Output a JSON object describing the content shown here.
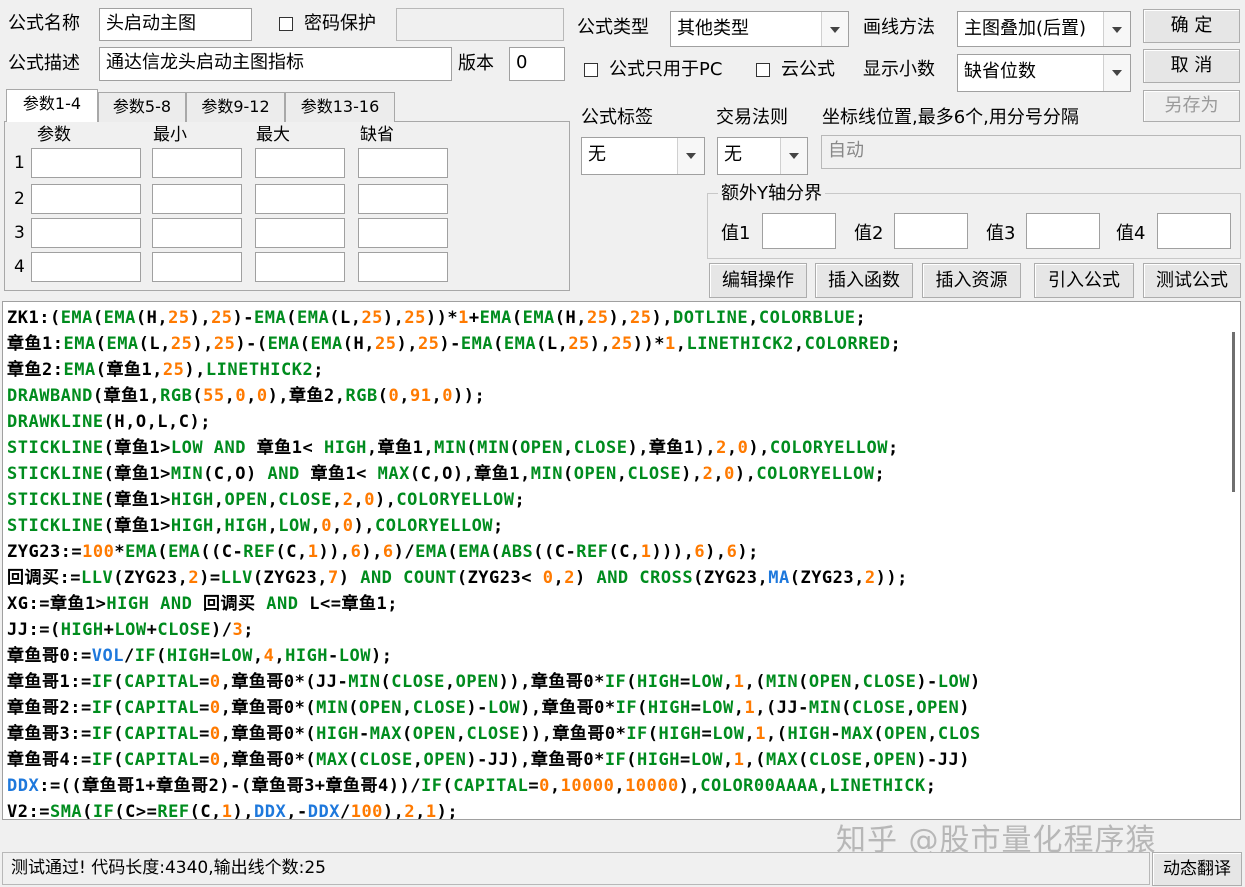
{
  "form": {
    "name_label": "公式名称",
    "name_value": "头启动主图",
    "password_label": "密码保护",
    "password_checked": false,
    "password_value": "",
    "desc_label": "公式描述",
    "desc_value": "通达信龙头启动主图指标",
    "version_label": "版本",
    "version_value": "0",
    "type_label": "公式类型",
    "type_value": "其他类型",
    "draw_label": "画线方法",
    "draw_value": "主图叠加(后置)",
    "pc_only_label": "公式只用于PC",
    "pc_only_checked": false,
    "cloud_label": "云公式",
    "cloud_checked": false,
    "decimals_label": "显示小数",
    "decimals_value": "缺省位数",
    "tag_label": "公式标签",
    "tag_value": "无",
    "trade_rule_label": "交易法则",
    "trade_rule_value": "无",
    "coord_label": "坐标线位置,最多6个,用分号分隔",
    "coord_value": "自动",
    "yaxis_group_label": "额外Y轴分界",
    "yaxis_values": [
      "值1",
      "值2",
      "值3",
      "值4"
    ]
  },
  "buttons": {
    "ok": "确  定",
    "cancel": "取  消",
    "save_as": "另存为",
    "edit_ops": "编辑操作",
    "insert_func": "插入函数",
    "insert_resource": "插入资源",
    "import_formula": "引入公式",
    "test_formula": "测试公式",
    "dynamic_translate": "动态翻译"
  },
  "tabs": [
    "参数1-4",
    "参数5-8",
    "参数9-12",
    "参数13-16"
  ],
  "param_table": {
    "headers": [
      "参数",
      "最小",
      "最大",
      "缺省"
    ],
    "rows": [
      "1",
      "2",
      "3",
      "4"
    ]
  },
  "colors": {
    "default": "#000000",
    "function": "#008c1e",
    "number": "#ff7a00",
    "keyword": "#1e78dc"
  },
  "code": [
    [
      [
        "ZK1:(",
        "d"
      ],
      [
        "EMA",
        "f"
      ],
      [
        "(",
        "d"
      ],
      [
        "EMA",
        "f"
      ],
      [
        "(H,",
        "d"
      ],
      [
        "25",
        "n"
      ],
      [
        "),",
        "d"
      ],
      [
        "25",
        "n"
      ],
      [
        ")-",
        "d"
      ],
      [
        "EMA",
        "f"
      ],
      [
        "(",
        "d"
      ],
      [
        "EMA",
        "f"
      ],
      [
        "(L,",
        "d"
      ],
      [
        "25",
        "n"
      ],
      [
        "),",
        "d"
      ],
      [
        "25",
        "n"
      ],
      [
        "))*",
        "d"
      ],
      [
        "1",
        "n"
      ],
      [
        "+",
        "d"
      ],
      [
        "EMA",
        "f"
      ],
      [
        "(",
        "d"
      ],
      [
        "EMA",
        "f"
      ],
      [
        "(H,",
        "d"
      ],
      [
        "25",
        "n"
      ],
      [
        "),",
        "d"
      ],
      [
        "25",
        "n"
      ],
      [
        "),",
        "d"
      ],
      [
        "DOTLINE",
        "f"
      ],
      [
        ",",
        "d"
      ],
      [
        "COLORBLUE",
        "f"
      ],
      [
        ";",
        "d"
      ]
    ],
    [
      [
        "章鱼1:",
        "d"
      ],
      [
        "EMA",
        "f"
      ],
      [
        "(",
        "d"
      ],
      [
        "EMA",
        "f"
      ],
      [
        "(L,",
        "d"
      ],
      [
        "25",
        "n"
      ],
      [
        "),",
        "d"
      ],
      [
        "25",
        "n"
      ],
      [
        ")-(",
        "d"
      ],
      [
        "EMA",
        "f"
      ],
      [
        "(",
        "d"
      ],
      [
        "EMA",
        "f"
      ],
      [
        "(H,",
        "d"
      ],
      [
        "25",
        "n"
      ],
      [
        "),",
        "d"
      ],
      [
        "25",
        "n"
      ],
      [
        ")-",
        "d"
      ],
      [
        "EMA",
        "f"
      ],
      [
        "(",
        "d"
      ],
      [
        "EMA",
        "f"
      ],
      [
        "(L,",
        "d"
      ],
      [
        "25",
        "n"
      ],
      [
        "),",
        "d"
      ],
      [
        "25",
        "n"
      ],
      [
        "))*",
        "d"
      ],
      [
        "1",
        "n"
      ],
      [
        ",",
        "d"
      ],
      [
        "LINETHICK2",
        "f"
      ],
      [
        ",",
        "d"
      ],
      [
        "COLORRED",
        "f"
      ],
      [
        ";",
        "d"
      ]
    ],
    [
      [
        "章鱼2:",
        "d"
      ],
      [
        "EMA",
        "f"
      ],
      [
        "(章鱼1,",
        "d"
      ],
      [
        "25",
        "n"
      ],
      [
        "),",
        "d"
      ],
      [
        "LINETHICK2",
        "f"
      ],
      [
        ";",
        "d"
      ]
    ],
    [
      [
        "DRAWBAND",
        "f"
      ],
      [
        "(章鱼1,",
        "d"
      ],
      [
        "RGB",
        "f"
      ],
      [
        "(",
        "d"
      ],
      [
        "55",
        "n"
      ],
      [
        ",",
        "d"
      ],
      [
        "0",
        "n"
      ],
      [
        ",",
        "d"
      ],
      [
        "0",
        "n"
      ],
      [
        "),章鱼2,",
        "d"
      ],
      [
        "RGB",
        "f"
      ],
      [
        "(",
        "d"
      ],
      [
        "0",
        "n"
      ],
      [
        ",",
        "d"
      ],
      [
        "91",
        "n"
      ],
      [
        ",",
        "d"
      ],
      [
        "0",
        "n"
      ],
      [
        "));",
        "d"
      ]
    ],
    [
      [
        "DRAWKLINE",
        "f"
      ],
      [
        "(H,O,L,C);",
        "d"
      ]
    ],
    [
      [
        "STICKLINE",
        "f"
      ],
      [
        "(章鱼1>",
        "d"
      ],
      [
        "LOW AND",
        "f"
      ],
      [
        " 章鱼1< ",
        "d"
      ],
      [
        "HIGH",
        "f"
      ],
      [
        ",章鱼1,",
        "d"
      ],
      [
        "MIN",
        "f"
      ],
      [
        "(",
        "d"
      ],
      [
        "MIN",
        "f"
      ],
      [
        "(",
        "d"
      ],
      [
        "OPEN",
        "f"
      ],
      [
        ",",
        "d"
      ],
      [
        "CLOSE",
        "f"
      ],
      [
        "),章鱼1),",
        "d"
      ],
      [
        "2",
        "n"
      ],
      [
        ",",
        "d"
      ],
      [
        "0",
        "n"
      ],
      [
        "),",
        "d"
      ],
      [
        "COLORYELLOW",
        "f"
      ],
      [
        ";",
        "d"
      ]
    ],
    [
      [
        "STICKLINE",
        "f"
      ],
      [
        "(章鱼1>",
        "d"
      ],
      [
        "MIN",
        "f"
      ],
      [
        "(C,O) ",
        "d"
      ],
      [
        "AND",
        "f"
      ],
      [
        " 章鱼1< ",
        "d"
      ],
      [
        "MAX",
        "f"
      ],
      [
        "(C,O),章鱼1,",
        "d"
      ],
      [
        "MIN",
        "f"
      ],
      [
        "(",
        "d"
      ],
      [
        "OPEN",
        "f"
      ],
      [
        ",",
        "d"
      ],
      [
        "CLOSE",
        "f"
      ],
      [
        "),",
        "d"
      ],
      [
        "2",
        "n"
      ],
      [
        ",",
        "d"
      ],
      [
        "0",
        "n"
      ],
      [
        "),",
        "d"
      ],
      [
        "COLORYELLOW",
        "f"
      ],
      [
        ";",
        "d"
      ]
    ],
    [
      [
        "STICKLINE",
        "f"
      ],
      [
        "(章鱼1>",
        "d"
      ],
      [
        "HIGH",
        "f"
      ],
      [
        ",",
        "d"
      ],
      [
        "OPEN",
        "f"
      ],
      [
        ",",
        "d"
      ],
      [
        "CLOSE",
        "f"
      ],
      [
        ",",
        "d"
      ],
      [
        "2",
        "n"
      ],
      [
        ",",
        "d"
      ],
      [
        "0",
        "n"
      ],
      [
        "),",
        "d"
      ],
      [
        "COLORYELLOW",
        "f"
      ],
      [
        ";",
        "d"
      ]
    ],
    [
      [
        "STICKLINE",
        "f"
      ],
      [
        "(章鱼1>",
        "d"
      ],
      [
        "HIGH",
        "f"
      ],
      [
        ",",
        "d"
      ],
      [
        "HIGH",
        "f"
      ],
      [
        ",",
        "d"
      ],
      [
        "LOW",
        "f"
      ],
      [
        ",",
        "d"
      ],
      [
        "0",
        "n"
      ],
      [
        ",",
        "d"
      ],
      [
        "0",
        "n"
      ],
      [
        "),",
        "d"
      ],
      [
        "COLORYELLOW",
        "f"
      ],
      [
        ";",
        "d"
      ]
    ],
    [
      [
        "ZYG23:=",
        "d"
      ],
      [
        "100",
        "n"
      ],
      [
        "*",
        "d"
      ],
      [
        "EMA",
        "f"
      ],
      [
        "(",
        "d"
      ],
      [
        "EMA",
        "f"
      ],
      [
        "((C-",
        "d"
      ],
      [
        "REF",
        "f"
      ],
      [
        "(C,",
        "d"
      ],
      [
        "1",
        "n"
      ],
      [
        ")),",
        "d"
      ],
      [
        "6",
        "n"
      ],
      [
        "),",
        "d"
      ],
      [
        "6",
        "n"
      ],
      [
        ")/",
        "d"
      ],
      [
        "EMA",
        "f"
      ],
      [
        "(",
        "d"
      ],
      [
        "EMA",
        "f"
      ],
      [
        "(",
        "d"
      ],
      [
        "ABS",
        "f"
      ],
      [
        "((C-",
        "d"
      ],
      [
        "REF",
        "f"
      ],
      [
        "(C,",
        "d"
      ],
      [
        "1",
        "n"
      ],
      [
        "))),",
        "d"
      ],
      [
        "6",
        "n"
      ],
      [
        "),",
        "d"
      ],
      [
        "6",
        "n"
      ],
      [
        ");",
        "d"
      ]
    ],
    [
      [
        "回调买:=",
        "d"
      ],
      [
        "LLV",
        "f"
      ],
      [
        "(ZYG23,",
        "d"
      ],
      [
        "2",
        "n"
      ],
      [
        ")=",
        "d"
      ],
      [
        "LLV",
        "f"
      ],
      [
        "(ZYG23,",
        "d"
      ],
      [
        "7",
        "n"
      ],
      [
        ") ",
        "d"
      ],
      [
        "AND COUNT",
        "f"
      ],
      [
        "(ZYG23< ",
        "d"
      ],
      [
        "0",
        "n"
      ],
      [
        ",",
        "d"
      ],
      [
        "2",
        "n"
      ],
      [
        ") ",
        "d"
      ],
      [
        "AND CROSS",
        "f"
      ],
      [
        "(ZYG23,",
        "d"
      ],
      [
        "MA",
        "k"
      ],
      [
        "(ZYG23,",
        "d"
      ],
      [
        "2",
        "n"
      ],
      [
        "));",
        "d"
      ]
    ],
    [
      [
        "XG:=章鱼1>",
        "d"
      ],
      [
        "HIGH AND",
        "f"
      ],
      [
        " 回调买 ",
        "d"
      ],
      [
        "AND",
        "f"
      ],
      [
        " L<=章鱼1;",
        "d"
      ]
    ],
    [
      [
        "JJ:=(",
        "d"
      ],
      [
        "HIGH",
        "f"
      ],
      [
        "+",
        "d"
      ],
      [
        "LOW",
        "f"
      ],
      [
        "+",
        "d"
      ],
      [
        "CLOSE",
        "f"
      ],
      [
        ")/",
        "d"
      ],
      [
        "3",
        "n"
      ],
      [
        ";",
        "d"
      ]
    ],
    [
      [
        "章鱼哥0:=",
        "d"
      ],
      [
        "VOL",
        "k"
      ],
      [
        "/",
        "d"
      ],
      [
        "IF",
        "f"
      ],
      [
        "(",
        "d"
      ],
      [
        "HIGH",
        "f"
      ],
      [
        "=",
        "d"
      ],
      [
        "LOW",
        "f"
      ],
      [
        ",",
        "d"
      ],
      [
        "4",
        "n"
      ],
      [
        ",",
        "d"
      ],
      [
        "HIGH",
        "f"
      ],
      [
        "-",
        "d"
      ],
      [
        "LOW",
        "f"
      ],
      [
        ");",
        "d"
      ]
    ],
    [
      [
        "章鱼哥1:=",
        "d"
      ],
      [
        "IF",
        "f"
      ],
      [
        "(",
        "d"
      ],
      [
        "CAPITAL",
        "f"
      ],
      [
        "=",
        "d"
      ],
      [
        "0",
        "n"
      ],
      [
        ",章鱼哥0*(JJ-",
        "d"
      ],
      [
        "MIN",
        "f"
      ],
      [
        "(",
        "d"
      ],
      [
        "CLOSE",
        "f"
      ],
      [
        ",",
        "d"
      ],
      [
        "OPEN",
        "f"
      ],
      [
        ")),章鱼哥0*",
        "d"
      ],
      [
        "IF",
        "f"
      ],
      [
        "(",
        "d"
      ],
      [
        "HIGH",
        "f"
      ],
      [
        "=",
        "d"
      ],
      [
        "LOW",
        "f"
      ],
      [
        ",",
        "d"
      ],
      [
        "1",
        "n"
      ],
      [
        ",(",
        "d"
      ],
      [
        "MIN",
        "f"
      ],
      [
        "(",
        "d"
      ],
      [
        "OPEN",
        "f"
      ],
      [
        ",",
        "d"
      ],
      [
        "CLOSE",
        "f"
      ],
      [
        ")-",
        "d"
      ],
      [
        "LOW",
        "f"
      ],
      [
        ")",
        "d"
      ]
    ],
    [
      [
        "章鱼哥2:=",
        "d"
      ],
      [
        "IF",
        "f"
      ],
      [
        "(",
        "d"
      ],
      [
        "CAPITAL",
        "f"
      ],
      [
        "=",
        "d"
      ],
      [
        "0",
        "n"
      ],
      [
        ",章鱼哥0*(",
        "d"
      ],
      [
        "MIN",
        "f"
      ],
      [
        "(",
        "d"
      ],
      [
        "OPEN",
        "f"
      ],
      [
        ",",
        "d"
      ],
      [
        "CLOSE",
        "f"
      ],
      [
        ")-",
        "d"
      ],
      [
        "LOW",
        "f"
      ],
      [
        "),章鱼哥0*",
        "d"
      ],
      [
        "IF",
        "f"
      ],
      [
        "(",
        "d"
      ],
      [
        "HIGH",
        "f"
      ],
      [
        "=",
        "d"
      ],
      [
        "LOW",
        "f"
      ],
      [
        ",",
        "d"
      ],
      [
        "1",
        "n"
      ],
      [
        ",(JJ-",
        "d"
      ],
      [
        "MIN",
        "f"
      ],
      [
        "(",
        "d"
      ],
      [
        "CLOSE",
        "f"
      ],
      [
        ",",
        "d"
      ],
      [
        "OPEN",
        "f"
      ],
      [
        ")",
        "d"
      ]
    ],
    [
      [
        "章鱼哥3:=",
        "d"
      ],
      [
        "IF",
        "f"
      ],
      [
        "(",
        "d"
      ],
      [
        "CAPITAL",
        "f"
      ],
      [
        "=",
        "d"
      ],
      [
        "0",
        "n"
      ],
      [
        ",章鱼哥0*(",
        "d"
      ],
      [
        "HIGH",
        "f"
      ],
      [
        "-",
        "d"
      ],
      [
        "MAX",
        "f"
      ],
      [
        "(",
        "d"
      ],
      [
        "OPEN",
        "f"
      ],
      [
        ",",
        "d"
      ],
      [
        "CLOSE",
        "f"
      ],
      [
        ")),章鱼哥0*",
        "d"
      ],
      [
        "IF",
        "f"
      ],
      [
        "(",
        "d"
      ],
      [
        "HIGH",
        "f"
      ],
      [
        "=",
        "d"
      ],
      [
        "LOW",
        "f"
      ],
      [
        ",",
        "d"
      ],
      [
        "1",
        "n"
      ],
      [
        ",(",
        "d"
      ],
      [
        "HIGH",
        "f"
      ],
      [
        "-",
        "d"
      ],
      [
        "MAX",
        "f"
      ],
      [
        "(",
        "d"
      ],
      [
        "OPEN",
        "f"
      ],
      [
        ",",
        "d"
      ],
      [
        "CLOS",
        "f"
      ]
    ],
    [
      [
        "章鱼哥4:=",
        "d"
      ],
      [
        "IF",
        "f"
      ],
      [
        "(",
        "d"
      ],
      [
        "CAPITAL",
        "f"
      ],
      [
        "=",
        "d"
      ],
      [
        "0",
        "n"
      ],
      [
        ",章鱼哥0*(",
        "d"
      ],
      [
        "MAX",
        "f"
      ],
      [
        "(",
        "d"
      ],
      [
        "CLOSE",
        "f"
      ],
      [
        ",",
        "d"
      ],
      [
        "OPEN",
        "f"
      ],
      [
        ")-JJ),章鱼哥0*",
        "d"
      ],
      [
        "IF",
        "f"
      ],
      [
        "(",
        "d"
      ],
      [
        "HIGH",
        "f"
      ],
      [
        "=",
        "d"
      ],
      [
        "LOW",
        "f"
      ],
      [
        ",",
        "d"
      ],
      [
        "1",
        "n"
      ],
      [
        ",(",
        "d"
      ],
      [
        "MAX",
        "f"
      ],
      [
        "(",
        "d"
      ],
      [
        "CLOSE",
        "f"
      ],
      [
        ",",
        "d"
      ],
      [
        "OPEN",
        "f"
      ],
      [
        ")-JJ)",
        "d"
      ]
    ],
    [
      [
        "DDX",
        "k"
      ],
      [
        ":=((章鱼哥1+章鱼哥2)-(章鱼哥3+章鱼哥4))/",
        "d"
      ],
      [
        "IF",
        "f"
      ],
      [
        "(",
        "d"
      ],
      [
        "CAPITAL",
        "f"
      ],
      [
        "=",
        "d"
      ],
      [
        "0",
        "n"
      ],
      [
        ",",
        "d"
      ],
      [
        "10000",
        "n"
      ],
      [
        ",",
        "d"
      ],
      [
        "10000",
        "n"
      ],
      [
        "),",
        "d"
      ],
      [
        "COLOR00AAAA",
        "f"
      ],
      [
        ",",
        "d"
      ],
      [
        "LINETHICK",
        "f"
      ],
      [
        ";",
        "d"
      ]
    ],
    [
      [
        "V2:=",
        "d"
      ],
      [
        "SMA",
        "f"
      ],
      [
        "(",
        "d"
      ],
      [
        "IF",
        "f"
      ],
      [
        "(C>=",
        "d"
      ],
      [
        "REF",
        "f"
      ],
      [
        "(C,",
        "d"
      ],
      [
        "1",
        "n"
      ],
      [
        "),",
        "d"
      ],
      [
        "DDX",
        "k"
      ],
      [
        ",-",
        "d"
      ],
      [
        "DDX",
        "k"
      ],
      [
        "/",
        "d"
      ],
      [
        "100",
        "n"
      ],
      [
        "),",
        "d"
      ],
      [
        "2",
        "n"
      ],
      [
        ",",
        "d"
      ],
      [
        "1",
        "n"
      ],
      [
        ");",
        "d"
      ]
    ]
  ],
  "watermark": "知乎 @股市量化程序猿",
  "status_text": "测试通过! 代码长度:4340,输出线个数:25"
}
